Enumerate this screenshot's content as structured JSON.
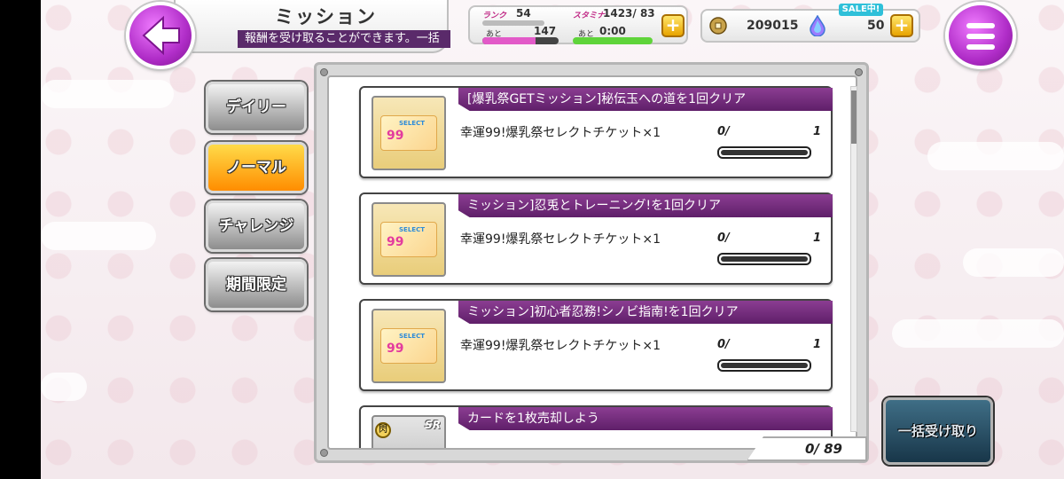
{
  "header": {
    "title": "ミッション",
    "ticker": "報酬を受け取ることができます。一括"
  },
  "status": {
    "rank_label": "ランク",
    "rank_value": "54",
    "rank_next_label": "あと",
    "rank_next_value": "147",
    "rank_progress": 0.7,
    "stamina_label": "スタミナ",
    "stamina_value": "1423/ 83",
    "stamina_next_label": "あと",
    "stamina_next_value": "0:00",
    "stamina_progress": 1.0,
    "coins": "209015",
    "sale_badge": "SALE中!",
    "gems": "50",
    "plus_symbol": "+"
  },
  "tabs": [
    {
      "label": "デイリー",
      "active": false
    },
    {
      "label": "ノーマル",
      "active": true
    },
    {
      "label": "チャレンジ",
      "active": false
    },
    {
      "label": "期間限定",
      "active": false
    }
  ],
  "missions": [
    {
      "title": "[爆乳祭GETミッション]秘伝玉への道を1回クリア",
      "reward": "幸運99!爆乳祭セレクトチケット×1",
      "progress_current": "0/",
      "progress_max": "1",
      "progress_fraction": 0,
      "thumb_tag": "SELECT",
      "thumb_num": "99"
    },
    {
      "title": "ミッション]忍兎とトレーニング!を1回クリア",
      "reward": "幸運99!爆乳祭セレクトチケット×1",
      "progress_current": "0/",
      "progress_max": "1",
      "progress_fraction": 0,
      "thumb_tag": "SELECT",
      "thumb_num": "99"
    },
    {
      "title": "ミッション]初心者忍務!シノビ指南!を1回クリア",
      "reward": "幸運99!爆乳祭セレクトチケット×1",
      "progress_current": "0/",
      "progress_max": "1",
      "progress_fraction": 0,
      "thumb_tag": "SELECT",
      "thumb_num": "99"
    },
    {
      "title": "カードを1枚売却しよう",
      "thumb_badge": "SR",
      "rarity_mark": "閃"
    }
  ],
  "footer": {
    "count": "0/ 89",
    "bulk_button": "一括受け取り"
  },
  "colors": {
    "accent_purple": "#b02dc8",
    "active_tab": "#ff8d00",
    "mission_header": "#5f1f69"
  }
}
